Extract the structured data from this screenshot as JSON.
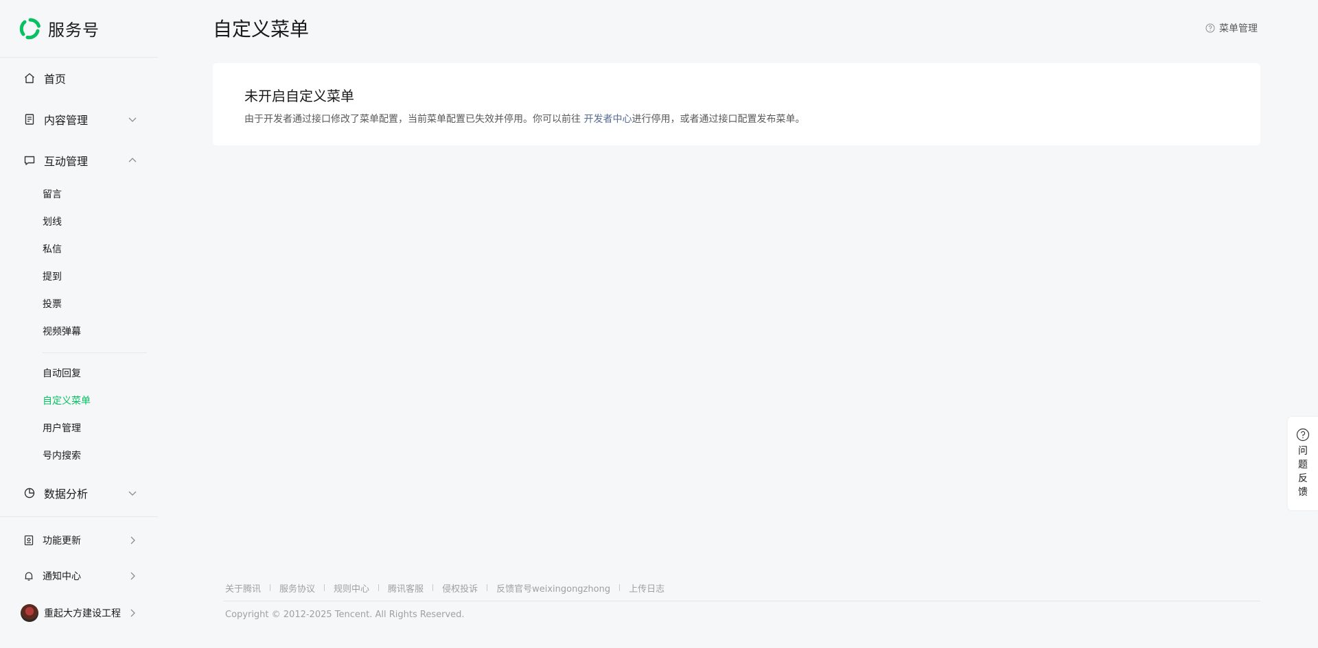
{
  "brand": {
    "title": "服务号"
  },
  "nav": {
    "home": "首页",
    "content": "内容管理",
    "interaction": "互动管理",
    "interaction_items": [
      "留言",
      "划线",
      "私信",
      "提到",
      "投票",
      "视频弹幕"
    ],
    "interaction_items2": [
      "自动回复",
      "自定义菜单",
      "用户管理",
      "号内搜索"
    ],
    "active_item": "自定义菜单",
    "analytics": "数据分析"
  },
  "bottom": {
    "updates": "功能更新",
    "notifications": "通知中心",
    "account": "重起大方建设工程"
  },
  "header": {
    "title": "自定义菜单",
    "link": "菜单管理"
  },
  "card": {
    "title": "未开启自定义菜单",
    "desc_before": "由于开发者通过接口修改了菜单配置，当前菜单配置已失效并停用。你可以前往 ",
    "desc_link": "开发者中心",
    "desc_after": "进行停用，或者通过接口配置发布菜单。"
  },
  "footer": {
    "links": [
      "关于腾讯",
      "服务协议",
      "规则中心",
      "腾讯客服",
      "侵权投诉",
      "反馈官号weixingongzhong",
      "上传日志"
    ],
    "copyright": "Copyright © 2012-2025 Tencent. All Rights Reserved."
  },
  "feedback": {
    "label": "问题反馈"
  },
  "colors": {
    "accent": "#07c160",
    "link": "#576b95"
  }
}
